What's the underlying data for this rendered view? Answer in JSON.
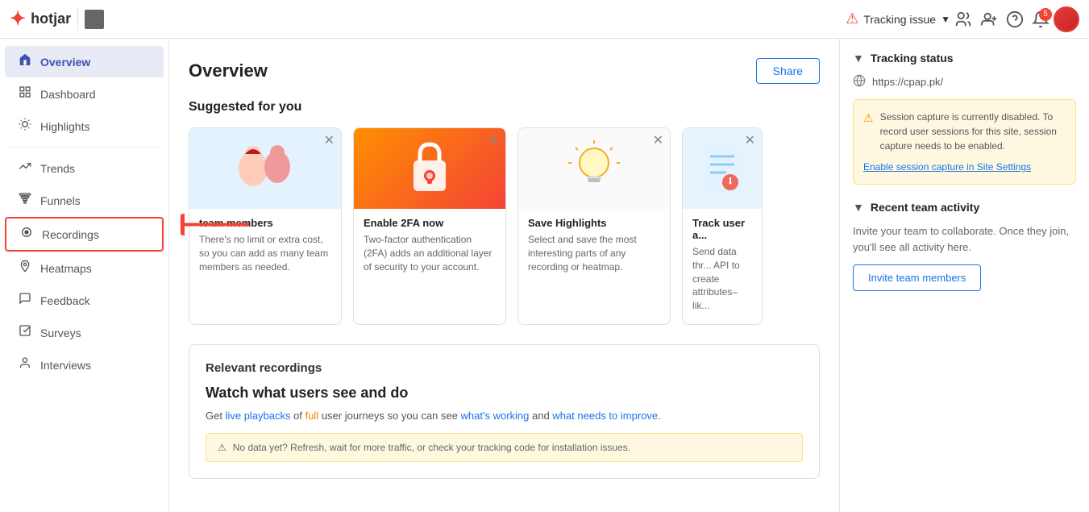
{
  "topbar": {
    "logo_text": "hotjar",
    "tracking_issue_label": "Tracking issue",
    "notification_count": "5"
  },
  "sidebar": {
    "items": [
      {
        "id": "overview",
        "label": "Overview",
        "icon": "🏠",
        "active": true
      },
      {
        "id": "dashboard",
        "label": "Dashboard",
        "icon": "⊞"
      },
      {
        "id": "highlights",
        "label": "Highlights",
        "icon": "💡"
      },
      {
        "id": "trends",
        "label": "Trends",
        "icon": "📈"
      },
      {
        "id": "funnels",
        "label": "Funnels",
        "icon": "📊"
      },
      {
        "id": "recordings",
        "label": "Recordings",
        "icon": "⏺",
        "highlighted": true
      },
      {
        "id": "heatmaps",
        "label": "Heatmaps",
        "icon": "🗺"
      },
      {
        "id": "feedback",
        "label": "Feedback",
        "icon": "💬"
      },
      {
        "id": "surveys",
        "label": "Surveys",
        "icon": "☑"
      },
      {
        "id": "interviews",
        "label": "Interviews",
        "icon": "👤"
      }
    ]
  },
  "content": {
    "page_title": "Overview",
    "share_label": "Share",
    "suggested_title": "Suggested for you",
    "cards": [
      {
        "id": "invite",
        "title": "team members",
        "title_prefix": "",
        "desc": "There's no limit or extra cost, so you can add as many team members as needed.",
        "bg": "blue-bg"
      },
      {
        "id": "2fa",
        "title": "Enable 2FA now",
        "desc": "Two-factor authentication (2FA) adds an additional layer of security to your account.",
        "bg": "orange-bg"
      },
      {
        "id": "highlights",
        "title": "Save Highlights",
        "desc": "Select and save the most interesting parts of any recording or heatmap.",
        "bg": "light-bg"
      },
      {
        "id": "track",
        "title": "Track user a...",
        "desc": "Send data thr... API to create attributes–lik...",
        "bg": "blue-light"
      }
    ],
    "recordings_section_title": "Relevant recordings",
    "recordings_main_title": "Watch what users see and do",
    "recordings_desc_part1": "Get ",
    "recordings_desc_live": "live playbacks",
    "recordings_desc_part2": " of ",
    "recordings_desc_full": "full",
    "recordings_desc_part3": " user journeys so you can see ",
    "recordings_desc_working": "what's working",
    "recordings_desc_part4": " and ",
    "recordings_desc_improve": "what needs to improve",
    "recordings_desc_part5": ".",
    "info_bar_text": "⚠ No data yet? Refresh, wait for more traffic, or check your tracking code for installation issues."
  },
  "right_panel": {
    "tracking_status_label": "Tracking status",
    "site_url": "https://cpap.pk/",
    "warning_text": "Session capture is currently disabled. To record user sessions for this site, session capture needs to be enabled.",
    "enable_link_label": "Enable session capture in Site Settings",
    "recent_activity_label": "Recent team activity",
    "recent_activity_desc": "Invite your team to collaborate. Once they join, you'll see all activity here.",
    "invite_btn_label": "Invite team members"
  }
}
